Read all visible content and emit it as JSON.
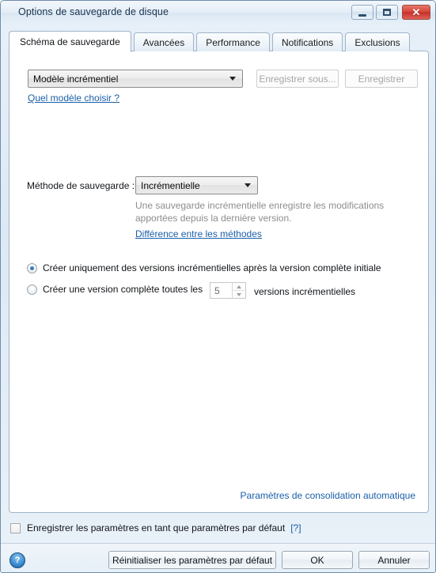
{
  "window": {
    "title": "Options de sauvegarde de disque",
    "buttons": {
      "minimize": "minimize-icon",
      "maximize": "maximize-icon",
      "close": "✕"
    }
  },
  "tabs": [
    {
      "label": "Schéma de sauvegarde",
      "active": true
    },
    {
      "label": "Avancées",
      "active": false
    },
    {
      "label": "Performance",
      "active": false
    },
    {
      "label": "Notifications",
      "active": false
    },
    {
      "label": "Exclusions",
      "active": false
    }
  ],
  "main": {
    "template": {
      "selected": "Modèle incrémentiel",
      "options": [
        "Modèle incrémentiel"
      ],
      "save_as_label": "Enregistrer sous...",
      "save_label": "Enregistrer",
      "help_link": "Quel modèle choisir ?"
    },
    "method": {
      "label": "Méthode de sauvegarde :",
      "selected": "Incrémentielle",
      "options": [
        "Incrémentielle"
      ],
      "description": "Une sauvegarde incrémentielle enregistre les modifications apportées depuis la dernière version.",
      "diff_link": "Différence entre les méthodes"
    },
    "version_rules": {
      "option_1": "Créer uniquement des versions incrémentielles après la version complète initiale",
      "option_1_selected": true,
      "option_2_prefix": "Créer une version complète toutes les",
      "option_2_suffix": "versions incrémentielles",
      "option_2_selected": false,
      "spinner_value": "5"
    },
    "consolidation_link": "Paramètres de consolidation automatique"
  },
  "defaults": {
    "checkbox_label": "Enregistrer les paramètres en tant que paramètres par défaut",
    "checked": false,
    "help_marker": "[?]"
  },
  "footer": {
    "help_icon": "?",
    "reset_label": "Réinitialiser les paramètres par défaut",
    "ok_label": "OK",
    "cancel_label": "Annuler"
  },
  "colors": {
    "link": "#1b5fa8",
    "accent": "#3f7ab5",
    "close_button": "#c6302a",
    "disabled_text": "#a5a5a5",
    "muted_text": "#8d8d8d"
  }
}
